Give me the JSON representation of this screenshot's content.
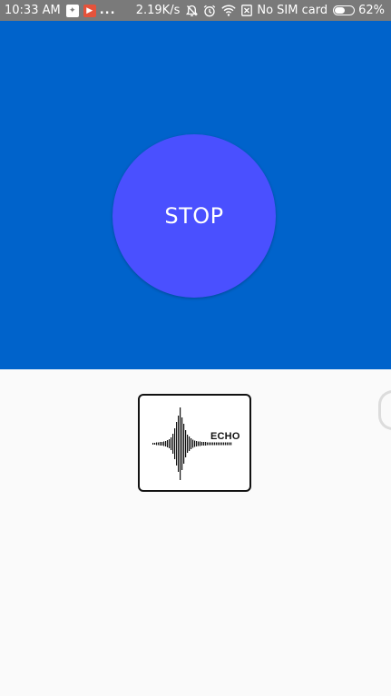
{
  "status_bar": {
    "time": "10:33 AM",
    "app_icons": [
      "ticket-app-icon",
      "video-app-icon"
    ],
    "more_indicator": "...",
    "net_speed": "2.19K/s",
    "icons": [
      "do-not-disturb-icon",
      "alarm-icon",
      "wifi-icon",
      "no-sim-icon",
      "battery-icon"
    ],
    "carrier": "No SIM card",
    "battery_percent": "62%",
    "battery_level": 0.62
  },
  "main": {
    "stop_label": "STOP",
    "logo_text": "ECHO"
  },
  "colors": {
    "status_bar": "#7a7a7a",
    "top_panel": "#0063cb",
    "stop_button": "#4a50ff",
    "background": "#fafafa"
  }
}
